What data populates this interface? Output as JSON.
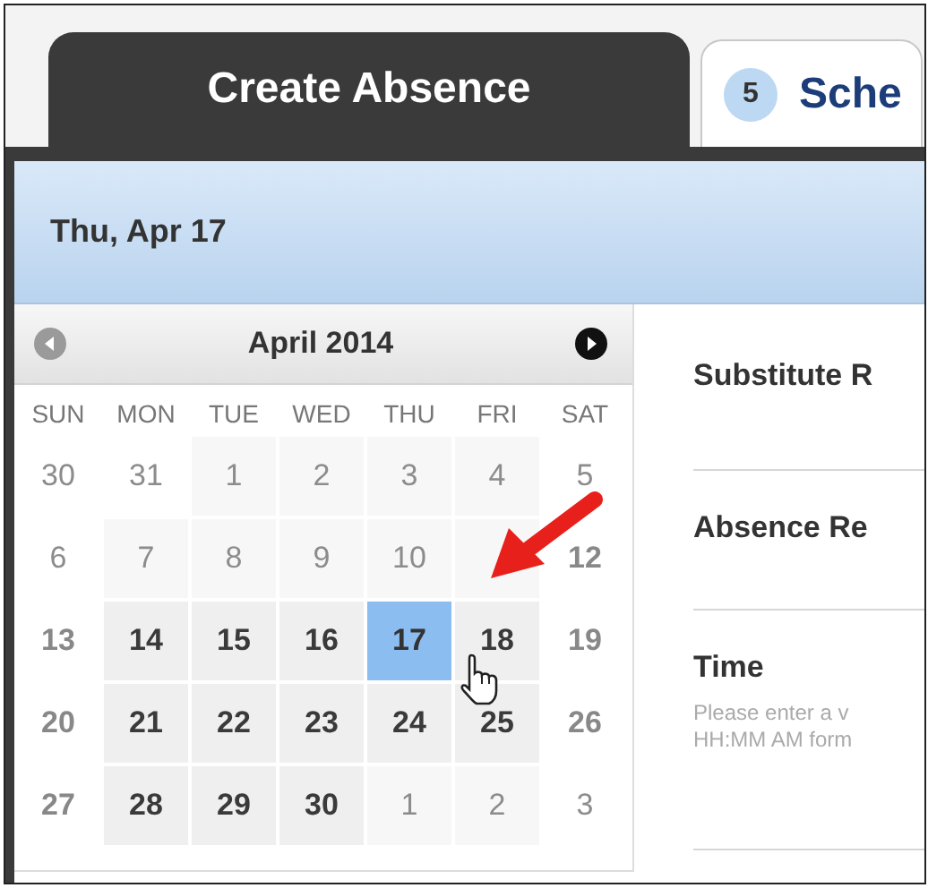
{
  "tabs": [
    {
      "kind": "plain",
      "label": "Create Absence",
      "selected": true
    },
    {
      "kind": "badge",
      "badge": "5",
      "label": "Sche",
      "selected": false
    }
  ],
  "date_header": "Thu, Apr 17",
  "calendar": {
    "month": "April 2014",
    "prev_disabled": true,
    "weekdays": [
      "SUN",
      "MON",
      "TUE",
      "WED",
      "THU",
      "FRI",
      "SAT"
    ],
    "weeks": [
      [
        {
          "label": "30",
          "kind": "other",
          "selected": false
        },
        {
          "label": "31",
          "kind": "other",
          "selected": false
        },
        {
          "label": "1",
          "kind": "past",
          "selected": false
        },
        {
          "label": "2",
          "kind": "past",
          "selected": false
        },
        {
          "label": "3",
          "kind": "past",
          "selected": false
        },
        {
          "label": "4",
          "kind": "past",
          "selected": false
        },
        {
          "label": "5",
          "kind": "other",
          "selected": false
        }
      ],
      [
        {
          "label": "6",
          "kind": "other",
          "selected": false
        },
        {
          "label": "7",
          "kind": "past",
          "selected": false
        },
        {
          "label": "8",
          "kind": "past",
          "selected": false
        },
        {
          "label": "9",
          "kind": "past",
          "selected": false
        },
        {
          "label": "10",
          "kind": "past",
          "selected": false
        },
        {
          "kind": "covered",
          "selected": false
        },
        {
          "label": "12",
          "kind": "weekend",
          "selected": false
        }
      ],
      [
        {
          "label": "13",
          "kind": "weekend",
          "selected": false
        },
        {
          "label": "14",
          "kind": "weekday",
          "selected": false
        },
        {
          "label": "15",
          "kind": "weekday",
          "selected": false
        },
        {
          "label": "16",
          "kind": "weekday",
          "selected": false
        },
        {
          "label": "17",
          "kind": "weekday",
          "selected": true
        },
        {
          "label": "18",
          "kind": "weekday",
          "selected": false
        },
        {
          "label": "19",
          "kind": "weekend",
          "selected": false
        }
      ],
      [
        {
          "label": "20",
          "kind": "weekend",
          "selected": false
        },
        {
          "label": "21",
          "kind": "weekday",
          "selected": false
        },
        {
          "label": "22",
          "kind": "weekday",
          "selected": false
        },
        {
          "label": "23",
          "kind": "weekday",
          "selected": false
        },
        {
          "label": "24",
          "kind": "weekday",
          "selected": false
        },
        {
          "label": "25",
          "kind": "weekday",
          "selected": false
        },
        {
          "label": "26",
          "kind": "weekend",
          "selected": false
        }
      ],
      [
        {
          "label": "27",
          "kind": "weekend",
          "selected": false
        },
        {
          "label": "28",
          "kind": "weekday",
          "selected": false
        },
        {
          "label": "29",
          "kind": "weekday",
          "selected": false
        },
        {
          "label": "30",
          "kind": "weekday",
          "selected": false
        },
        {
          "label": "1",
          "kind": "next",
          "selected": false
        },
        {
          "label": "2",
          "kind": "next",
          "selected": false
        },
        {
          "label": "3",
          "kind": "other",
          "selected": false
        }
      ]
    ]
  },
  "fields": [
    {
      "label": "Substitute R"
    },
    {
      "label": "Absence Re"
    },
    {
      "label": "Time",
      "hint": [
        "Please enter a v",
        "HH:MM AM form"
      ]
    }
  ]
}
